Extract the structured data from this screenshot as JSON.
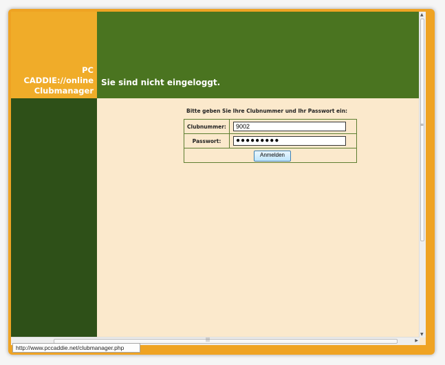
{
  "header": {
    "brand_line1": "PC CADDIE://online",
    "brand_line2": "Clubmanager",
    "login_status": "Sie sind nicht eingeloggt."
  },
  "login": {
    "instruction": "Bitte geben Sie Ihre Clubnummer und Ihr Passwort ein:",
    "club_label": "Clubnummer:",
    "club_value": "9002",
    "password_label": "Passwort:",
    "password_value": "●●●●●●●●●",
    "submit_label": "Anmelden"
  },
  "status_bar": {
    "url": "http://www.pccaddie.net/clubmanager.php"
  },
  "colors": {
    "frame": "#efa323",
    "banner_left": "#f0ac29",
    "banner_right": "#4a7420",
    "sidebar": "#2e5018",
    "content": "#fbe9cc",
    "table_border": "#5d7d2f"
  }
}
